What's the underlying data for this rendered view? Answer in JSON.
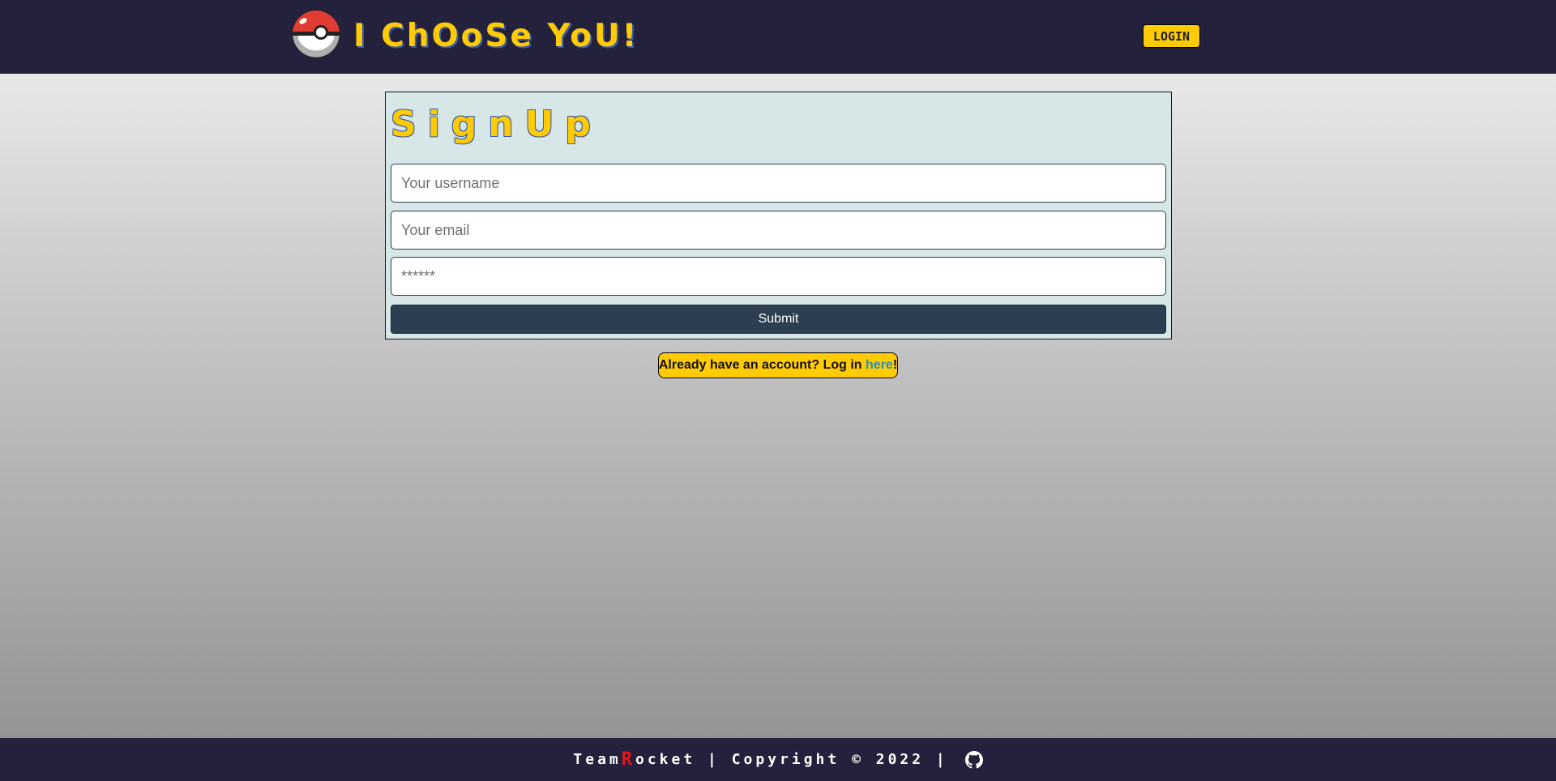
{
  "header": {
    "brand": "I ChOoSe YoU!",
    "login_label": "LOGIN",
    "logo_icon": "pokeball-icon"
  },
  "signup": {
    "title": "SignUp",
    "username_placeholder": "Your username",
    "email_placeholder": "Your email",
    "password_placeholder": "******",
    "submit_label": "Submit"
  },
  "login_prompt": {
    "text": "Already have an account? Log in ",
    "link_text": "here",
    "suffix": "!"
  },
  "footer": {
    "team_prefix": "Team ",
    "team_r": "R",
    "team_rest": "ocket",
    "copyright": " | Copyright © 2022 | ",
    "github_icon": "github-icon"
  },
  "colors": {
    "nav_bg": "#23213b",
    "accent_yellow": "#ffcb05",
    "card_bg": "#d7e7e7",
    "submit_bg": "#2c3e50",
    "link": "#2a8fb0",
    "rocket_red": "#e8141c"
  }
}
